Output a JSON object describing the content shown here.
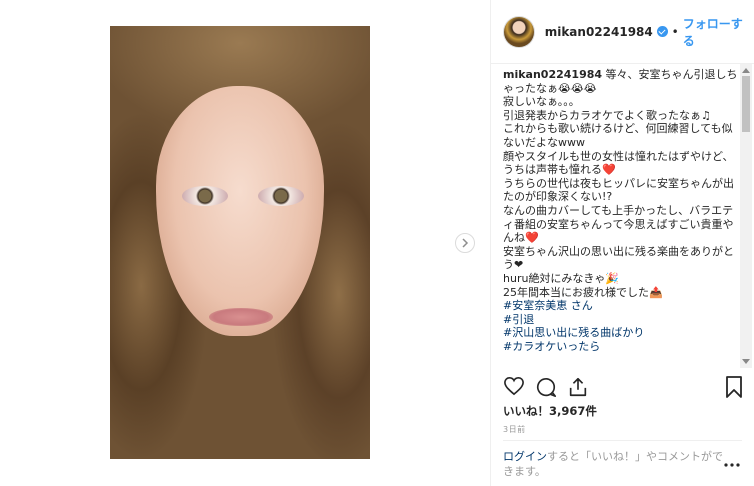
{
  "post": {
    "username": "mikan02241984",
    "follow_separator": "•",
    "follow_label": "フォローする",
    "verified_icon": "verified-badge-icon"
  },
  "caption": {
    "author": "mikan02241984",
    "lines": [
      "等々、安室ちゃん引退しちゃったなぁ😭😭😭",
      "寂しいなぁ。。。",
      "引退発表からカラオケでよく歌ったなぁ♫",
      "これからも歌い続けるけど、何回練習しても似ないだよなwww",
      "顔やスタイルも世の女性は憧れたはずやけど、うちは声帯も憧れる❤️",
      "うちらの世代は夜もヒッパレに安室ちゃんが出たのが印象深くない!?",
      "なんの曲カバーしても上手かったし、バラエティ番組の安室ちゃんって今思えばすごい貴重やんね❤️",
      "安室ちゃん沢山の思い出に残る楽曲をありがとう❤",
      "huru絶対にみなきゃ🎉",
      "25年間本当にお疲れ様でした📤"
    ],
    "hashtags": [
      "#安室奈美恵 さん",
      "#引退",
      "#沢山思い出に残る曲ばかり",
      "#カラオケいったら"
    ]
  },
  "engagement": {
    "likes_text": "いいね！3,967件",
    "timestamp": "3日前"
  },
  "footer": {
    "login_link": "ログイン",
    "login_text": "すると「いいね！」やコメントができます。"
  },
  "icons": [
    "heart-icon",
    "comment-icon",
    "share-icon",
    "bookmark-icon",
    "next-arrow-icon",
    "more-options-icon"
  ],
  "colors": {
    "accent": "#3897f0",
    "hashtag": "#003569",
    "muted": "#999999"
  }
}
